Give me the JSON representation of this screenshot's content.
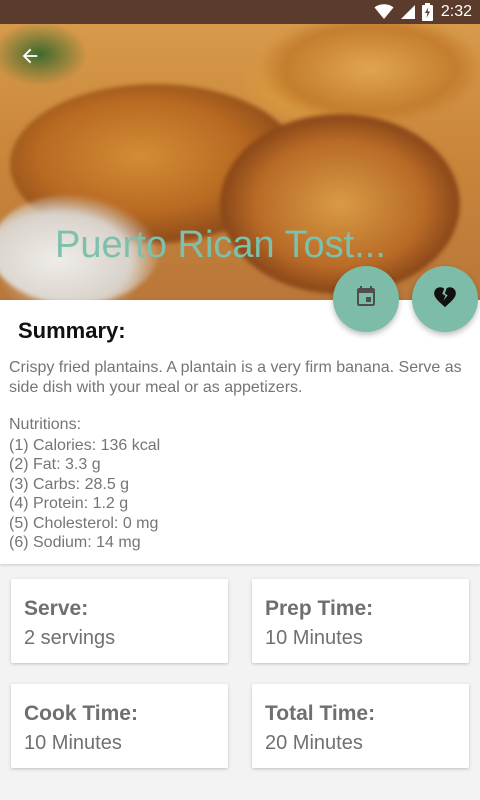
{
  "status_bar": {
    "time": "2:32",
    "icons": [
      "wifi-icon",
      "cellular-signal-icon",
      "battery-charging-icon"
    ]
  },
  "header": {
    "title": "Puerto Rican Tost...",
    "back_icon": "arrow-left-icon"
  },
  "actions": {
    "calendar_icon": "calendar-icon",
    "favorite_icon": "broken-heart-icon"
  },
  "summary": {
    "heading": "Summary:",
    "description": "Crispy fried plantains. A plantain is a very firm banana. Serve as side dish with your meal or as appetizers.",
    "nutrition_heading": "Nutritions:",
    "nutrition_items": [
      "(1) Calories: 136 kcal",
      "(2) Fat: 3.3 g",
      "(3) Carbs: 28.5 g",
      "(4) Protein: 1.2 g",
      "(5) Cholesterol: 0 mg",
      "(6) Sodium: 14 mg"
    ]
  },
  "info": {
    "serve": {
      "label": "Serve:",
      "value": "2 servings"
    },
    "prep": {
      "label": "Prep Time:",
      "value": "10 Minutes"
    },
    "cook": {
      "label": "Cook Time:",
      "value": "10 Minutes"
    },
    "total": {
      "label": "Total Time:",
      "value": "20 Minutes"
    }
  },
  "colors": {
    "status_bar": "#5a3b2c",
    "accent": "#7dbca8",
    "title_text": "#7cc1ad"
  }
}
